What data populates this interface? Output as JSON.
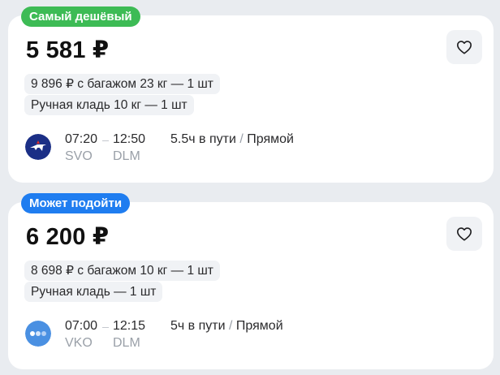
{
  "offers": [
    {
      "badge": "Самый дешёвый",
      "badge_color": "#3dbb55",
      "price": "5 581 ₽",
      "baggage": "9 896 ₽ с багажом 23 кг — 1 шт",
      "hand_luggage": "Ручная кладь 10 кг — 1 шт",
      "airline_icon": "aeroflot-logo-icon",
      "depart_time": "07:20",
      "arrive_time": "12:50",
      "from_code": "SVO",
      "to_code": "DLM",
      "duration": "5.5ч в пути",
      "separator": "/",
      "route_type": "Прямой"
    },
    {
      "badge": "Может подойти",
      "badge_color": "#1f7df0",
      "price": "6 200 ₽",
      "baggage": "8 698 ₽ с багажом 10 кг — 1 шт",
      "hand_luggage": "Ручная кладь — 1 шт",
      "airline_icon": "three-dots-airline-icon",
      "depart_time": "07:00",
      "arrive_time": "12:15",
      "from_code": "VKO",
      "to_code": "DLM",
      "duration": "5ч в пути",
      "separator": "/",
      "route_type": "Прямой"
    }
  ],
  "icons": {
    "favorite": "heart-icon"
  }
}
